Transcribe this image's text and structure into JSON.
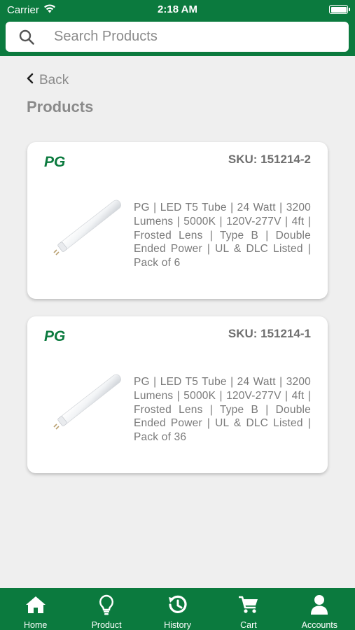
{
  "status_bar": {
    "carrier": "Carrier",
    "time": "2:18 AM"
  },
  "search": {
    "placeholder": "Search Products",
    "value": ""
  },
  "nav": {
    "back_label": "Back",
    "page_title": "Products"
  },
  "products": [
    {
      "brand": "PG",
      "sku": "SKU: 151214-2",
      "description": "PG | LED T5 Tube | 24 Watt | 3200 Lumens | 5000K | 120V-277V | 4ft | Frosted Lens | Type B | Double Ended Power | UL & DLC Listed | Pack of 6"
    },
    {
      "brand": "PG",
      "sku": "SKU: 151214-1",
      "description": "PG | LED T5 Tube | 24 Watt | 3200 Lumens | 5000K | 120V-277V | 4ft | Frosted Lens | Type B | Double Ended Power | UL & DLC Listed | Pack of 36"
    }
  ],
  "tabbar": {
    "items": [
      {
        "label": "Home",
        "icon": "home-icon"
      },
      {
        "label": "Product",
        "icon": "lightbulb-icon"
      },
      {
        "label": "History",
        "icon": "history-icon"
      },
      {
        "label": "Cart",
        "icon": "cart-icon"
      },
      {
        "label": "Accounts",
        "icon": "user-icon"
      }
    ]
  },
  "colors": {
    "brand_green": "#0b7a3e",
    "background": "#efefef",
    "muted_text": "#8a8a8a"
  }
}
